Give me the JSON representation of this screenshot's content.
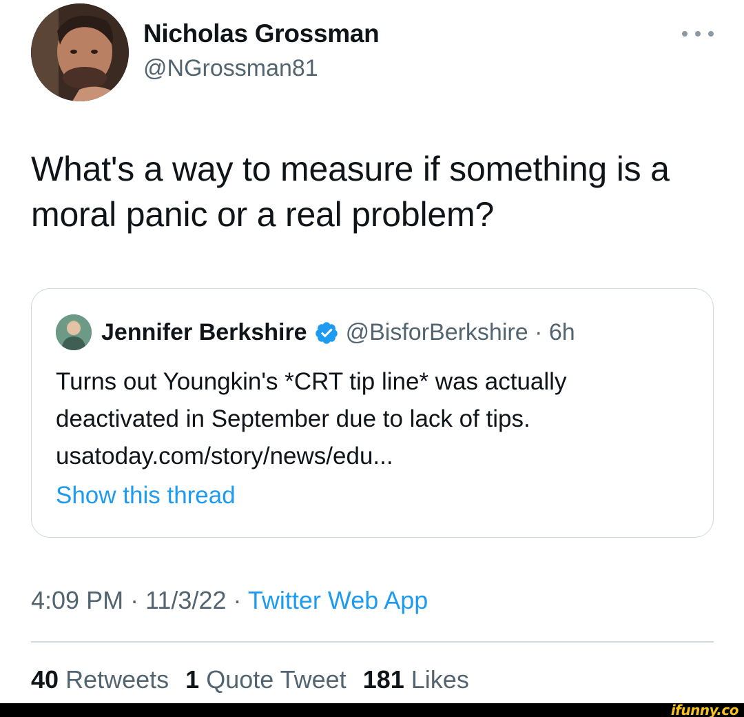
{
  "author": {
    "name": "Nicholas Grossman",
    "handle": "@NGrossman81"
  },
  "more_icon": "more-horizontal-icon",
  "tweet": {
    "text": "What's a way to measure if something is a moral panic or a real problem?"
  },
  "quoted_tweet": {
    "name": "Jennifer Berkshire",
    "verified_icon": "verified-badge-icon",
    "handle_time": "@BisforBerkshire · 6h",
    "text": "Turns out Youngkin's *CRT tip line* was actually deactivated in September due to lack of tips. usatoday.com/story/news/edu...",
    "show_thread": "Show this thread"
  },
  "meta": {
    "time_date": "4:09 PM · 11/3/22 · ",
    "app": "Twitter Web App"
  },
  "stats": {
    "retweets_count": "40",
    "retweets_label": "Retweets",
    "quotes_count": "1",
    "quotes_label": "Quote Tweet",
    "likes_count": "181",
    "likes_label": "Likes"
  },
  "watermark": "ifunny.co",
  "colors": {
    "accent": "#1d9bf0",
    "secondary_text": "#536471",
    "border": "#cfd9de"
  }
}
